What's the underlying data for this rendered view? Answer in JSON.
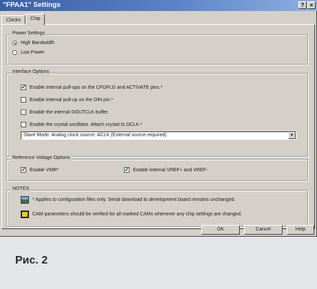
{
  "window": {
    "title": "\"FPAA1\" Settings",
    "help_btn": "?",
    "close_btn": "×"
  },
  "tabs": [
    {
      "label": "Clocks"
    },
    {
      "label": "Chip"
    }
  ],
  "power": {
    "title": "Power Settings",
    "options": [
      {
        "label": "High Bandwidth",
        "selected": true
      },
      {
        "label": "Low Power",
        "selected": false
      }
    ]
  },
  "interface": {
    "title": "Interface Options",
    "checks": [
      {
        "label": "Enable internal pull-ups on the CFGFLG and ACTIVATE pins.*",
        "checked": true
      },
      {
        "label": "Enable internal pull-up on the DIN pin.*",
        "checked": false
      },
      {
        "label": "Enable the internal DOUTCLK buffer.",
        "checked": false
      },
      {
        "label": "Enable the crystal oscillator. Attach crystal to DCLK.*",
        "checked": false
      }
    ],
    "mode_select": "Slave Mode. Analog clock source: ACLK (External source required)"
  },
  "reference": {
    "title": "Reference Voltage Options",
    "vmr": {
      "label": "Enable VMR*",
      "checked": true
    },
    "vref": {
      "label": "Enable Internal VREF+ and VREF-",
      "checked": true
    }
  },
  "notes": {
    "title": "NOTES",
    "items": [
      {
        "icon": "board-icon",
        "text": "* Applies to configuration files only. Serial download to development board remains unchanged."
      },
      {
        "icon": "warning-icon",
        "text": "CAM parameters should be verified for all marked CAMs whenever any chip settings are changed."
      }
    ]
  },
  "buttons": {
    "ok": "OK",
    "cancel": "Cancel",
    "help": "Help"
  },
  "caption": "Рис. 2"
}
